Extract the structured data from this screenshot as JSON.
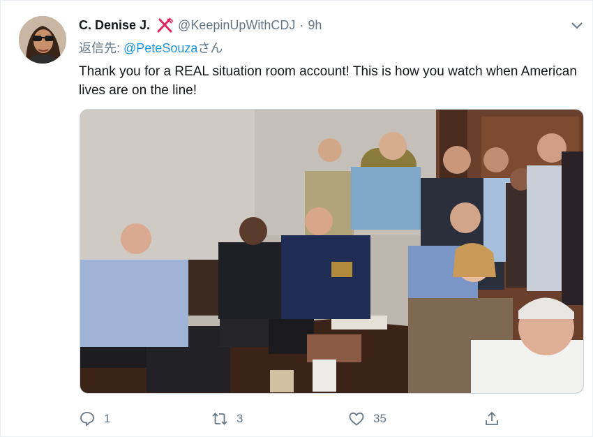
{
  "tweet": {
    "author_name": "C. Denise J.",
    "author_handle": "@KeepinUpWithCDJ",
    "separator": "·",
    "time": "9h",
    "replying_prefix": "返信先: ",
    "replying_mention": "@PeteSouza",
    "replying_suffix": "さん",
    "text": "Thank you for a REAL situation room account! This is how you watch when American lives are on the line!"
  },
  "actions": {
    "reply_count": "1",
    "retweet_count": "3",
    "like_count": "35"
  },
  "icons": {
    "badge": "fork-and-knife-icon",
    "menu": "chevron-down-icon",
    "reply": "reply-icon",
    "retweet": "retweet-icon",
    "like": "heart-icon",
    "share": "share-icon"
  },
  "colors": {
    "text": "#14171a",
    "secondary": "#657786",
    "link": "#1b95e0",
    "badge": "#e0245e"
  }
}
